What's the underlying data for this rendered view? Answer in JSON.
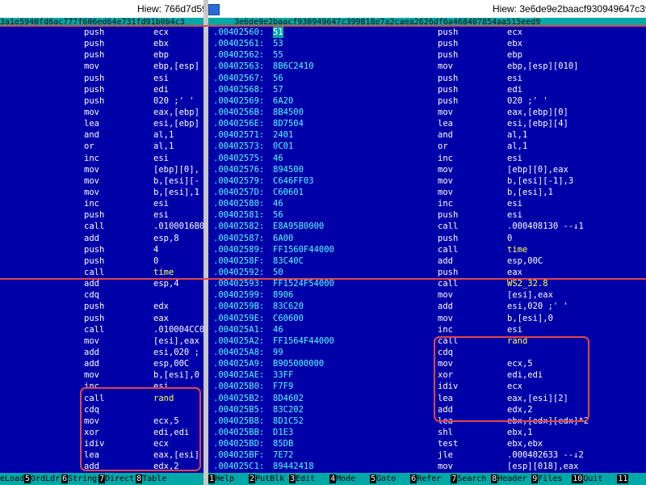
{
  "left": {
    "title": "Hiew: 766d7d59",
    "path": "3a1e5940fd6ac777f606ed64e731fd91b0b4c3",
    "rows": [
      {
        "mn": "push",
        "op": "ecx"
      },
      {
        "mn": "push",
        "op": "ebx"
      },
      {
        "mn": "push",
        "op": "ebp"
      },
      {
        "mn": "mov",
        "op": "ebp,[esp]"
      },
      {
        "mn": "push",
        "op": "esi"
      },
      {
        "mn": "push",
        "op": "edi"
      },
      {
        "mn": "push",
        "op": "020 ;' '"
      },
      {
        "mn": "mov",
        "op": "eax,[ebp]"
      },
      {
        "mn": "lea",
        "op": "esi,[ebp]"
      },
      {
        "mn": "and",
        "op": "al,1"
      },
      {
        "mn": "or",
        "op": "al,1"
      },
      {
        "mn": "inc",
        "op": "esi"
      },
      {
        "mn": "mov",
        "op": "[ebp][0],"
      },
      {
        "mn": "mov",
        "op": "b,[esi][-"
      },
      {
        "mn": "mov",
        "op": "b,[esi],1"
      },
      {
        "mn": "inc",
        "op": "esi"
      },
      {
        "mn": "push",
        "op": "esi"
      },
      {
        "mn": "call",
        "op": ".0100016B0"
      },
      {
        "mn": "add",
        "op": "esp,8"
      },
      {
        "mn": "push",
        "op": "4"
      },
      {
        "mn": "push",
        "op": "0"
      },
      {
        "mn": "call",
        "op": "time"
      },
      {
        "mn": "add",
        "op": "esp,4"
      },
      {
        "mn": "cdq",
        "op": ""
      },
      {
        "mn": "push",
        "op": "edx"
      },
      {
        "mn": "push",
        "op": "eax"
      },
      {
        "mn": "call",
        "op": ".010004CC0"
      },
      {
        "mn": "mov",
        "op": "[esi],eax"
      },
      {
        "mn": "add",
        "op": "esi,020 ;"
      },
      {
        "mn": "add",
        "op": "esp,00C"
      },
      {
        "mn": "mov",
        "op": "b,[esi],0"
      },
      {
        "mn": "inc",
        "op": "esi"
      },
      {
        "mn": "call",
        "op": "rand"
      },
      {
        "mn": "cdq",
        "op": ""
      },
      {
        "mn": "mov",
        "op": "ecx,5"
      },
      {
        "mn": "xor",
        "op": "edi,edi"
      },
      {
        "mn": "idiv",
        "op": "ecx"
      },
      {
        "mn": "lea",
        "op": "eax,[esi]"
      },
      {
        "mn": "add",
        "op": "edx,2"
      }
    ],
    "fkeys": [
      {
        "n": "",
        "l": "eLoad"
      },
      {
        "n": "5",
        "l": "OrdLdr"
      },
      {
        "n": "6",
        "l": "String"
      },
      {
        "n": "7",
        "l": "Direct"
      },
      {
        "n": "8",
        "l": "Table"
      }
    ]
  },
  "right": {
    "title": "Hiew: 3e6de9e2baacf930949647c399818e7a2",
    "path": "3e6de9e2baacf930949647c399818e7a2caea2626df6a468407854aa515eed9",
    "rows": [
      {
        "addr": ".00402560:",
        "hex": "51",
        "mn": "push",
        "op": "ecx"
      },
      {
        "addr": ".00402561:",
        "hex": "53",
        "mn": "push",
        "op": "ebx"
      },
      {
        "addr": ".00402562:",
        "hex": "55",
        "mn": "push",
        "op": "ebp"
      },
      {
        "addr": ".00402563:",
        "hex": "8B6C2410",
        "mn": "mov",
        "op": "ebp,[esp][010]"
      },
      {
        "addr": ".00402567:",
        "hex": "56",
        "mn": "push",
        "op": "esi"
      },
      {
        "addr": ".00402568:",
        "hex": "57",
        "mn": "push",
        "op": "edi"
      },
      {
        "addr": ".00402569:",
        "hex": "6A20",
        "mn": "push",
        "op": "020 ;' '"
      },
      {
        "addr": ".0040256B:",
        "hex": "8B4500",
        "mn": "mov",
        "op": "eax,[ebp][0]"
      },
      {
        "addr": ".0040256E:",
        "hex": "8D7504",
        "mn": "lea",
        "op": "esi,[ebp][4]"
      },
      {
        "addr": ".00402571:",
        "hex": "2401",
        "mn": "and",
        "op": "al,1"
      },
      {
        "addr": ".00402573:",
        "hex": "0C01",
        "mn": "or",
        "op": "al,1"
      },
      {
        "addr": ".00402575:",
        "hex": "46",
        "mn": "inc",
        "op": "esi"
      },
      {
        "addr": ".00402576:",
        "hex": "894500",
        "mn": "mov",
        "op": "[ebp][0],eax"
      },
      {
        "addr": ".00402579:",
        "hex": "C646FF03",
        "mn": "mov",
        "op": "b,[esi][-1],3"
      },
      {
        "addr": ".0040257D:",
        "hex": "C60601",
        "mn": "mov",
        "op": "b,[esi],1"
      },
      {
        "addr": ".00402580:",
        "hex": "46",
        "mn": "inc",
        "op": "esi"
      },
      {
        "addr": ".00402581:",
        "hex": "56",
        "mn": "push",
        "op": "esi"
      },
      {
        "addr": ".00402582:",
        "hex": "E8A95B0000",
        "mn": "call",
        "op": ".000408130 --↓1"
      },
      {
        "addr": ".00402587:",
        "hex": "6A00",
        "mn": "push",
        "op": "0"
      },
      {
        "addr": ".00402589:",
        "hex": "FF1560F44000",
        "mn": "call",
        "op": "time"
      },
      {
        "addr": ".0040258F:",
        "hex": "83C40C",
        "mn": "add",
        "op": "esp,00C"
      },
      {
        "addr": ".00402592:",
        "hex": "50",
        "mn": "push",
        "op": "eax"
      },
      {
        "addr": ".00402593:",
        "hex": "FF1524F54000",
        "mn": "call",
        "op": "WS2_32.8"
      },
      {
        "addr": ".00402599:",
        "hex": "8906",
        "mn": "mov",
        "op": "[esi],eax"
      },
      {
        "addr": ".0040259B:",
        "hex": "83C620",
        "mn": "add",
        "op": "esi,020 ;' '"
      },
      {
        "addr": ".0040259E:",
        "hex": "C60600",
        "mn": "mov",
        "op": "b,[esi],0"
      },
      {
        "addr": ".004025A1:",
        "hex": "46",
        "mn": "inc",
        "op": "esi"
      },
      {
        "addr": ".004025A2:",
        "hex": "FF1564F44000",
        "mn": "call",
        "op": "rand"
      },
      {
        "addr": ".004025A8:",
        "hex": "99",
        "mn": "cdq",
        "op": ""
      },
      {
        "addr": ".004025A9:",
        "hex": "B905000000",
        "mn": "mov",
        "op": "ecx,5"
      },
      {
        "addr": ".004025AE:",
        "hex": "33FF",
        "mn": "xor",
        "op": "edi,edi"
      },
      {
        "addr": ".004025B0:",
        "hex": "F7F9",
        "mn": "idiv",
        "op": "ecx"
      },
      {
        "addr": ".004025B2:",
        "hex": "8D4602",
        "mn": "lea",
        "op": "eax,[esi][2]"
      },
      {
        "addr": ".004025B5:",
        "hex": "83C202",
        "mn": "add",
        "op": "edx,2"
      },
      {
        "addr": ".004025B8:",
        "hex": "8D1C52",
        "mn": "lea",
        "op": "ebx,[edx][edx]*2"
      },
      {
        "addr": ".004025BB:",
        "hex": "D1E3",
        "mn": "shl",
        "op": "ebx,1"
      },
      {
        "addr": ".004025BD:",
        "hex": "85DB",
        "mn": "test",
        "op": "ebx,ebx"
      },
      {
        "addr": ".004025BF:",
        "hex": "7E72",
        "mn": "jle",
        "op": ".000402633 --↓2"
      },
      {
        "addr": ".004025C1:",
        "hex": "89442418",
        "mn": "mov",
        "op": "[esp][018],eax"
      }
    ],
    "fkeys": [
      {
        "n": "1",
        "l": "Help"
      },
      {
        "n": "2",
        "l": "PutBlk"
      },
      {
        "n": "3",
        "l": "Edit"
      },
      {
        "n": "4",
        "l": "Mode"
      },
      {
        "n": "5",
        "l": "Goto"
      },
      {
        "n": "6",
        "l": "Refer"
      },
      {
        "n": "7",
        "l": "Search"
      },
      {
        "n": "8",
        "l": "Header"
      },
      {
        "n": "9",
        "l": "Files"
      },
      {
        "n": "10",
        "l": "Quit"
      },
      {
        "n": "11",
        "l": ""
      }
    ]
  }
}
